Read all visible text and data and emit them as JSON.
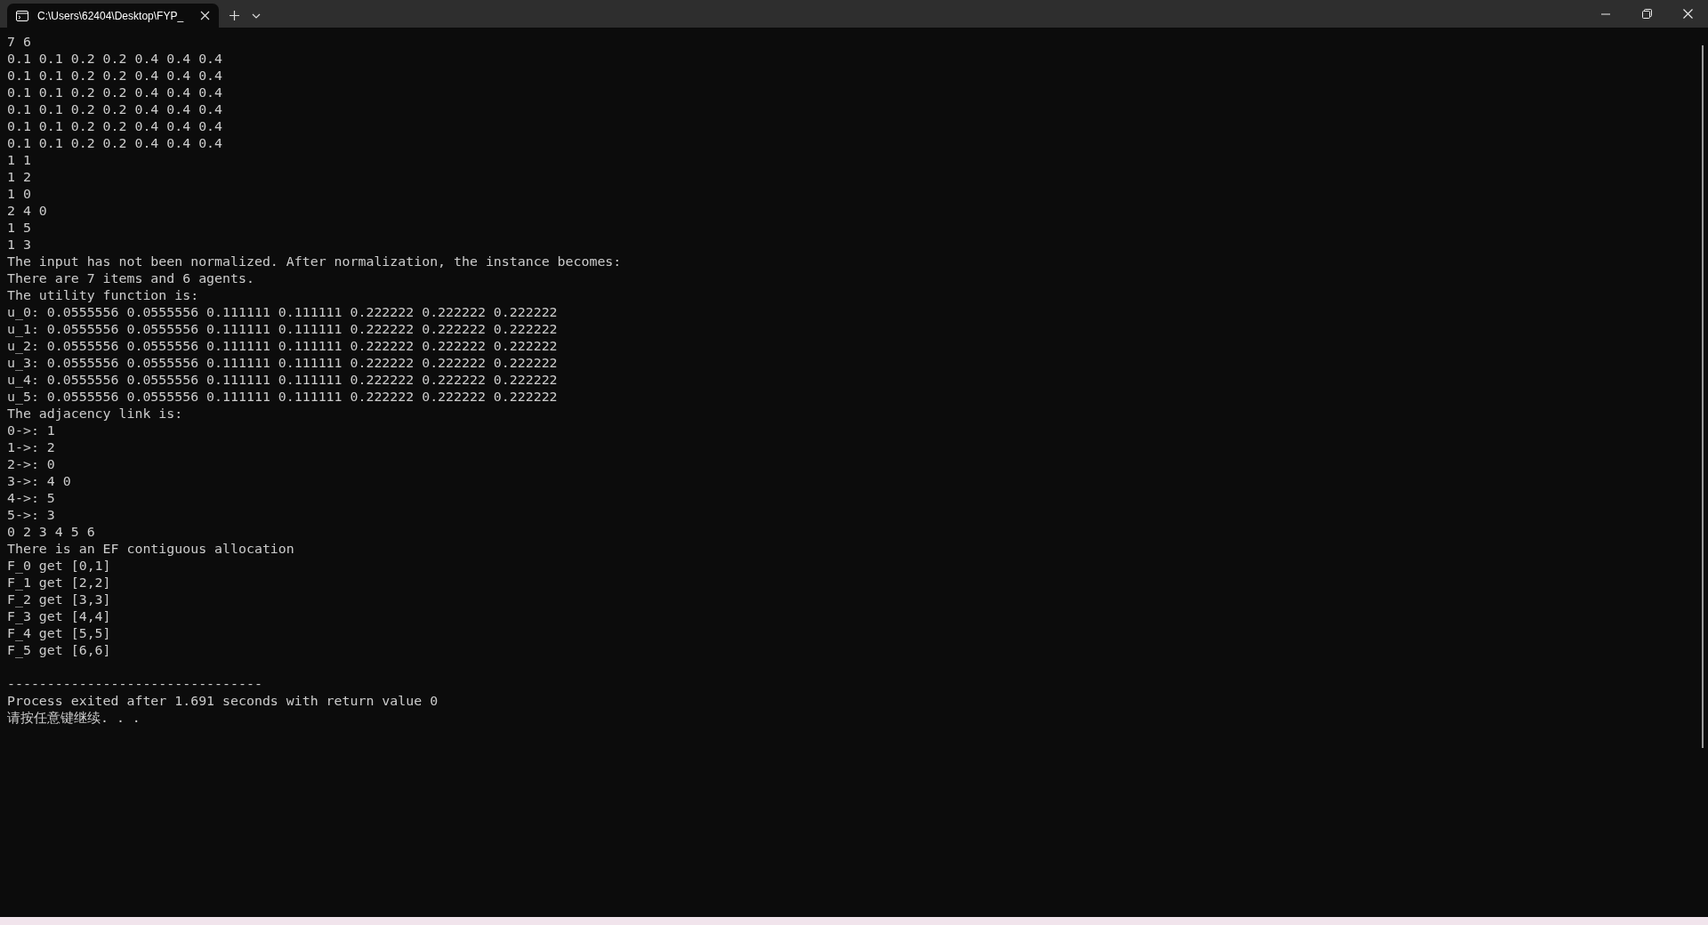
{
  "tab": {
    "title": "C:\\Users\\62404\\Desktop\\FYP_",
    "selected": true
  },
  "output": [
    "7 6",
    "0.1 0.1 0.2 0.2 0.4 0.4 0.4",
    "0.1 0.1 0.2 0.2 0.4 0.4 0.4",
    "0.1 0.1 0.2 0.2 0.4 0.4 0.4",
    "0.1 0.1 0.2 0.2 0.4 0.4 0.4",
    "0.1 0.1 0.2 0.2 0.4 0.4 0.4",
    "0.1 0.1 0.2 0.2 0.4 0.4 0.4",
    "1 1",
    "1 2",
    "1 0",
    "2 4 0",
    "1 5",
    "1 3",
    "The input has not been normalized. After normalization, the instance becomes:",
    "There are 7 items and 6 agents.",
    "The utility function is:",
    "u_0: 0.0555556 0.0555556 0.111111 0.111111 0.222222 0.222222 0.222222",
    "u_1: 0.0555556 0.0555556 0.111111 0.111111 0.222222 0.222222 0.222222",
    "u_2: 0.0555556 0.0555556 0.111111 0.111111 0.222222 0.222222 0.222222",
    "u_3: 0.0555556 0.0555556 0.111111 0.111111 0.222222 0.222222 0.222222",
    "u_4: 0.0555556 0.0555556 0.111111 0.111111 0.222222 0.222222 0.222222",
    "u_5: 0.0555556 0.0555556 0.111111 0.111111 0.222222 0.222222 0.222222",
    "The adjacency link is:",
    "0->: 1",
    "1->: 2",
    "2->: 0",
    "3->: 4 0",
    "4->: 5",
    "5->: 3",
    "0 2 3 4 5 6",
    "There is an EF contiguous allocation",
    "F_0 get [0,1]",
    "F_1 get [2,2]",
    "F_2 get [3,3]",
    "F_3 get [4,4]",
    "F_4 get [5,5]",
    "F_5 get [6,6]"
  ],
  "footer": {
    "rule": "--------------------------------",
    "lines": [
      "Process exited after 1.691 seconds with return value 0",
      "请按任意键继续. . ."
    ]
  }
}
